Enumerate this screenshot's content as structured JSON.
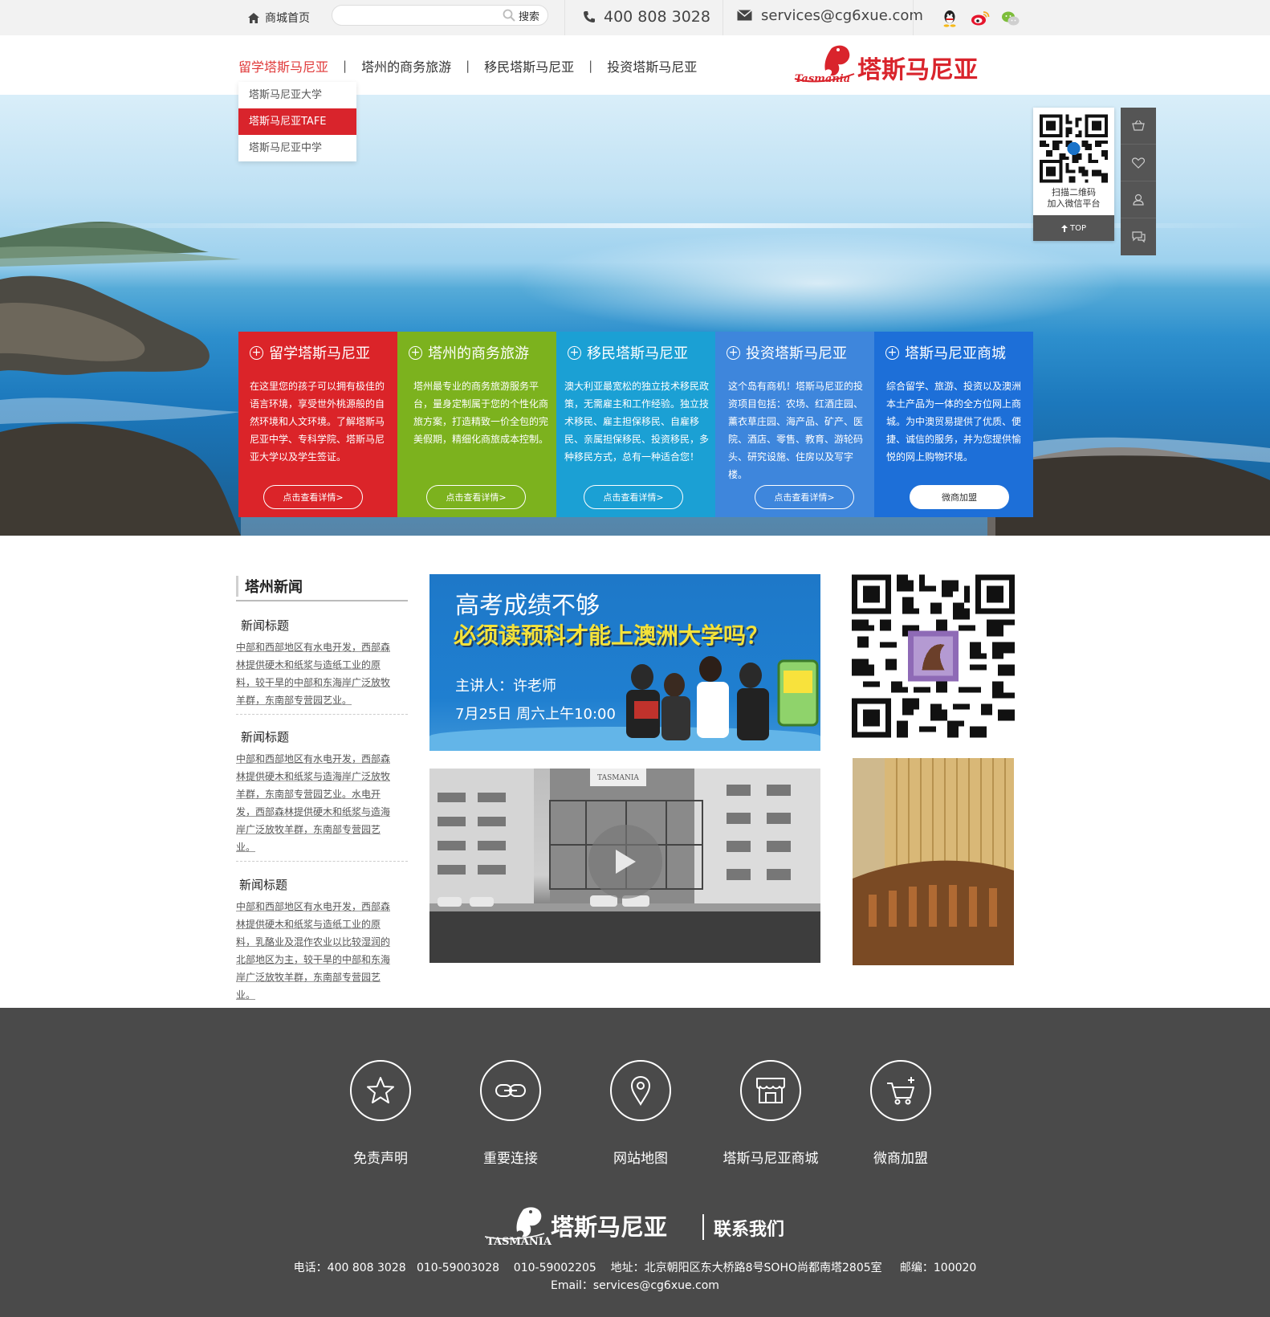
{
  "topbar": {
    "home_label": "商城首页",
    "search_placeholder": "",
    "search_button": "搜索",
    "phone": "400 808 3028",
    "email": "services@cg6xue.com"
  },
  "nav": {
    "items": [
      "留学塔斯马尼亚",
      "塔州的商务旅游",
      "移民塔斯马尼亚",
      "投资塔斯马尼亚"
    ],
    "separator": "|",
    "dropdown": [
      "塔斯马尼亚大学",
      "塔斯马尼亚TAFE",
      "塔斯马尼亚中学"
    ]
  },
  "logo": {
    "en": "Tasmania",
    "zh": "塔斯马尼亚"
  },
  "float_qr": {
    "caption_line1": "扫描二维码",
    "caption_line2": "加入微信平台",
    "top_label": "TOP"
  },
  "cards": [
    {
      "title": "留学塔斯马尼亚",
      "body": "在这里您的孩子可以拥有极佳的语言环境，享受世外桃源般的自然环境和人文环境。了解塔斯马尼亚中学、专科学院、塔斯马尼亚大学以及学生签证。",
      "button": "点击查看详情>"
    },
    {
      "title": "塔州的商务旅游",
      "body": "塔州最专业的商务旅游服务平台，量身定制属于您的个性化商旅方案，打造精致一价全包的完美假期，精细化商旅成本控制。",
      "button": "点击查看详情>"
    },
    {
      "title": "移民塔斯马尼亚",
      "body": "澳大利亚最宽松的独立技术移民政策，无需雇主和工作经验。独立技术移民、雇主担保移民、自雇移民、亲属担保移民、投资移民，多种移民方式，总有一种适合您！",
      "button": "点击查看详情>"
    },
    {
      "title": "投资塔斯马尼亚",
      "body": "这个岛有商机！塔斯马尼亚的投资项目包括：农场、红酒庄园、薰衣草庄园、海产品、矿产、医院、酒店、零售、教育、游轮码头、研究设施、住房以及写字楼。",
      "button": "点击查看详情>"
    },
    {
      "title": "塔斯马尼亚商城",
      "body": "综合留学、旅游、投资以及澳洲本土产品为一体的全方位网上商城。为中澳贸易提供了优质、便捷、诚信的服务，并为您提供愉悦的网上购物环境。",
      "button": "微商加盟"
    }
  ],
  "news": {
    "heading": "塔州新闻",
    "items": [
      {
        "title": "新闻标题",
        "desc": "中部和西部地区有水电开发，西部森林提供硬木和纸浆与造纸工业的原料，较干旱的中部和东海岸广泛放牧羊群，东南部专营园艺业。"
      },
      {
        "title": "新闻标题",
        "desc": "中部和西部地区有水电开发，西部森林提供硬木和纸浆与造海岸广泛放牧羊群，东南部专营园艺业。水电开发，西部森林提供硬木和纸浆与造海岸广泛放牧羊群，东南部专营园艺业。"
      },
      {
        "title": "新闻标题",
        "desc": "中部和西部地区有水电开发，西部森林提供硬木和纸浆与造纸工业的原料，乳酪业及混作农业以比较湿润的北部地区为主，较干旱的中部和东海岸广泛放牧羊群，东南部专营园艺业。"
      }
    ]
  },
  "banner": {
    "line1": "高考成绩不够",
    "line2": "必须读预科才能上澳洲大学吗？",
    "speaker": "主讲人：许老师",
    "time": "7月25日 周六上午10:00"
  },
  "video": {
    "sign": "TASMANIA"
  },
  "footer": {
    "links": [
      "免责声明",
      "重要连接",
      "网站地图",
      "塔斯马尼亚商城",
      "微商加盟"
    ],
    "logo_en": "TASMANIA",
    "logo_zh": "塔斯马尼亚",
    "contact_title": "联系我们",
    "contact_line1": "电话：400 808 3028   010-59003028    010-59002205    地址：北京朝阳区东大桥路8号SOHO尚都南塔2805室     邮编：100020",
    "contact_line2": "Email：services@cg6xue.com"
  },
  "colors": {
    "card_red": "#db2429",
    "card_green": "#7cb21e",
    "card_cyan": "#1ba0d4",
    "card_blue": "#3e86dc",
    "card_deepblue": "#1d6fd8",
    "nav_active": "#e03a3a",
    "footer_bg": "#4a4a4a"
  }
}
